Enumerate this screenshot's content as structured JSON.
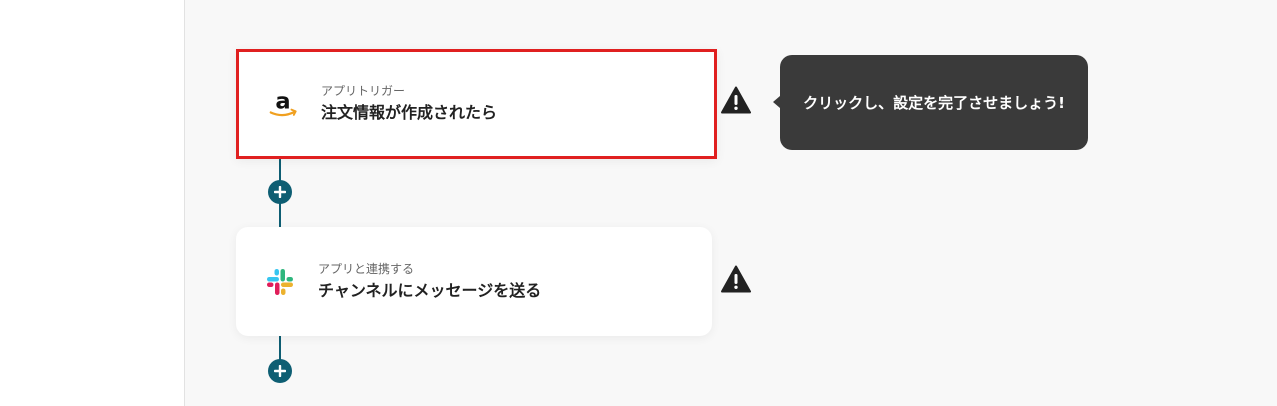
{
  "flow": {
    "steps": [
      {
        "app_icon": "amazon-icon",
        "subtitle": "アプリトリガー",
        "title": "注文情報が作成されたら",
        "status_icon": "warning-icon",
        "selected": true
      },
      {
        "app_icon": "slack-icon",
        "subtitle": "アプリと連携する",
        "title": "チャンネルにメッセージを送る",
        "status_icon": "warning-icon",
        "selected": false
      }
    ],
    "add_step_icon": "plus-icon"
  },
  "tooltip": {
    "text": "クリックし、設定を完了させましょう!"
  },
  "colors": {
    "accent": "#0e5e73",
    "selection_border": "#e02020",
    "tooltip_bg": "#3a3a3a",
    "amazon_arrow": "#f0a020"
  }
}
